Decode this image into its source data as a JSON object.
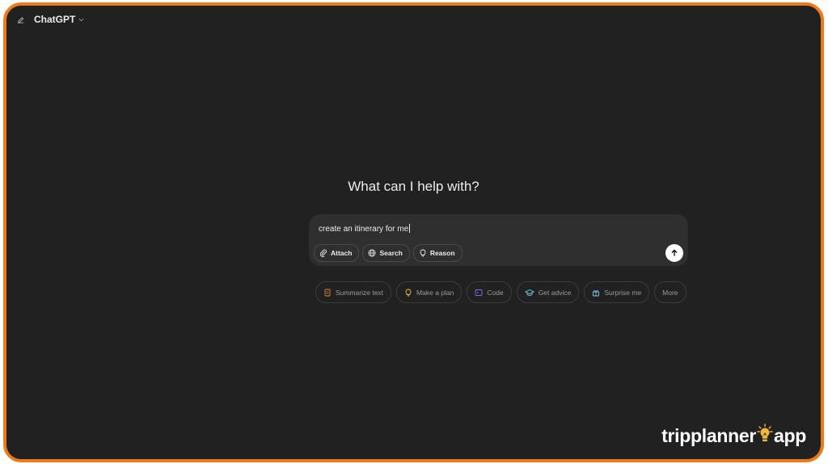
{
  "header": {
    "model_name": "ChatGPT",
    "new_chat_icon": "edit-icon",
    "model_dropdown_icon": "chevron-down-icon"
  },
  "main": {
    "heading": "What can I help with?"
  },
  "composer": {
    "input_value": "create an itinerary for me",
    "tools": [
      {
        "label": "Attach",
        "icon": "paperclip-icon"
      },
      {
        "label": "Search",
        "icon": "globe-icon"
      },
      {
        "label": "Reason",
        "icon": "lightbulb-icon"
      }
    ],
    "send_icon": "arrow-up-icon"
  },
  "suggestions": [
    {
      "label": "Summarize text",
      "icon": "document-icon",
      "color": "#e2873a"
    },
    {
      "label": "Make a plan",
      "icon": "lightbulb-icon",
      "color": "#e2c541"
    },
    {
      "label": "Code",
      "icon": "code-icon",
      "color": "#7b6ff0"
    },
    {
      "label": "Get advice",
      "icon": "graduation-cap-icon",
      "color": "#76d0eb"
    },
    {
      "label": "Surprise me",
      "icon": "gift-icon",
      "color": "#76d0eb"
    },
    {
      "label": "More"
    }
  ],
  "watermark": {
    "text_left": "tripplanner",
    "text_right": "app",
    "icon": "lightbulb-icon"
  },
  "colors": {
    "frame_border": "#ef7a1a",
    "background": "#212121",
    "composer": "#2f2f2f"
  }
}
